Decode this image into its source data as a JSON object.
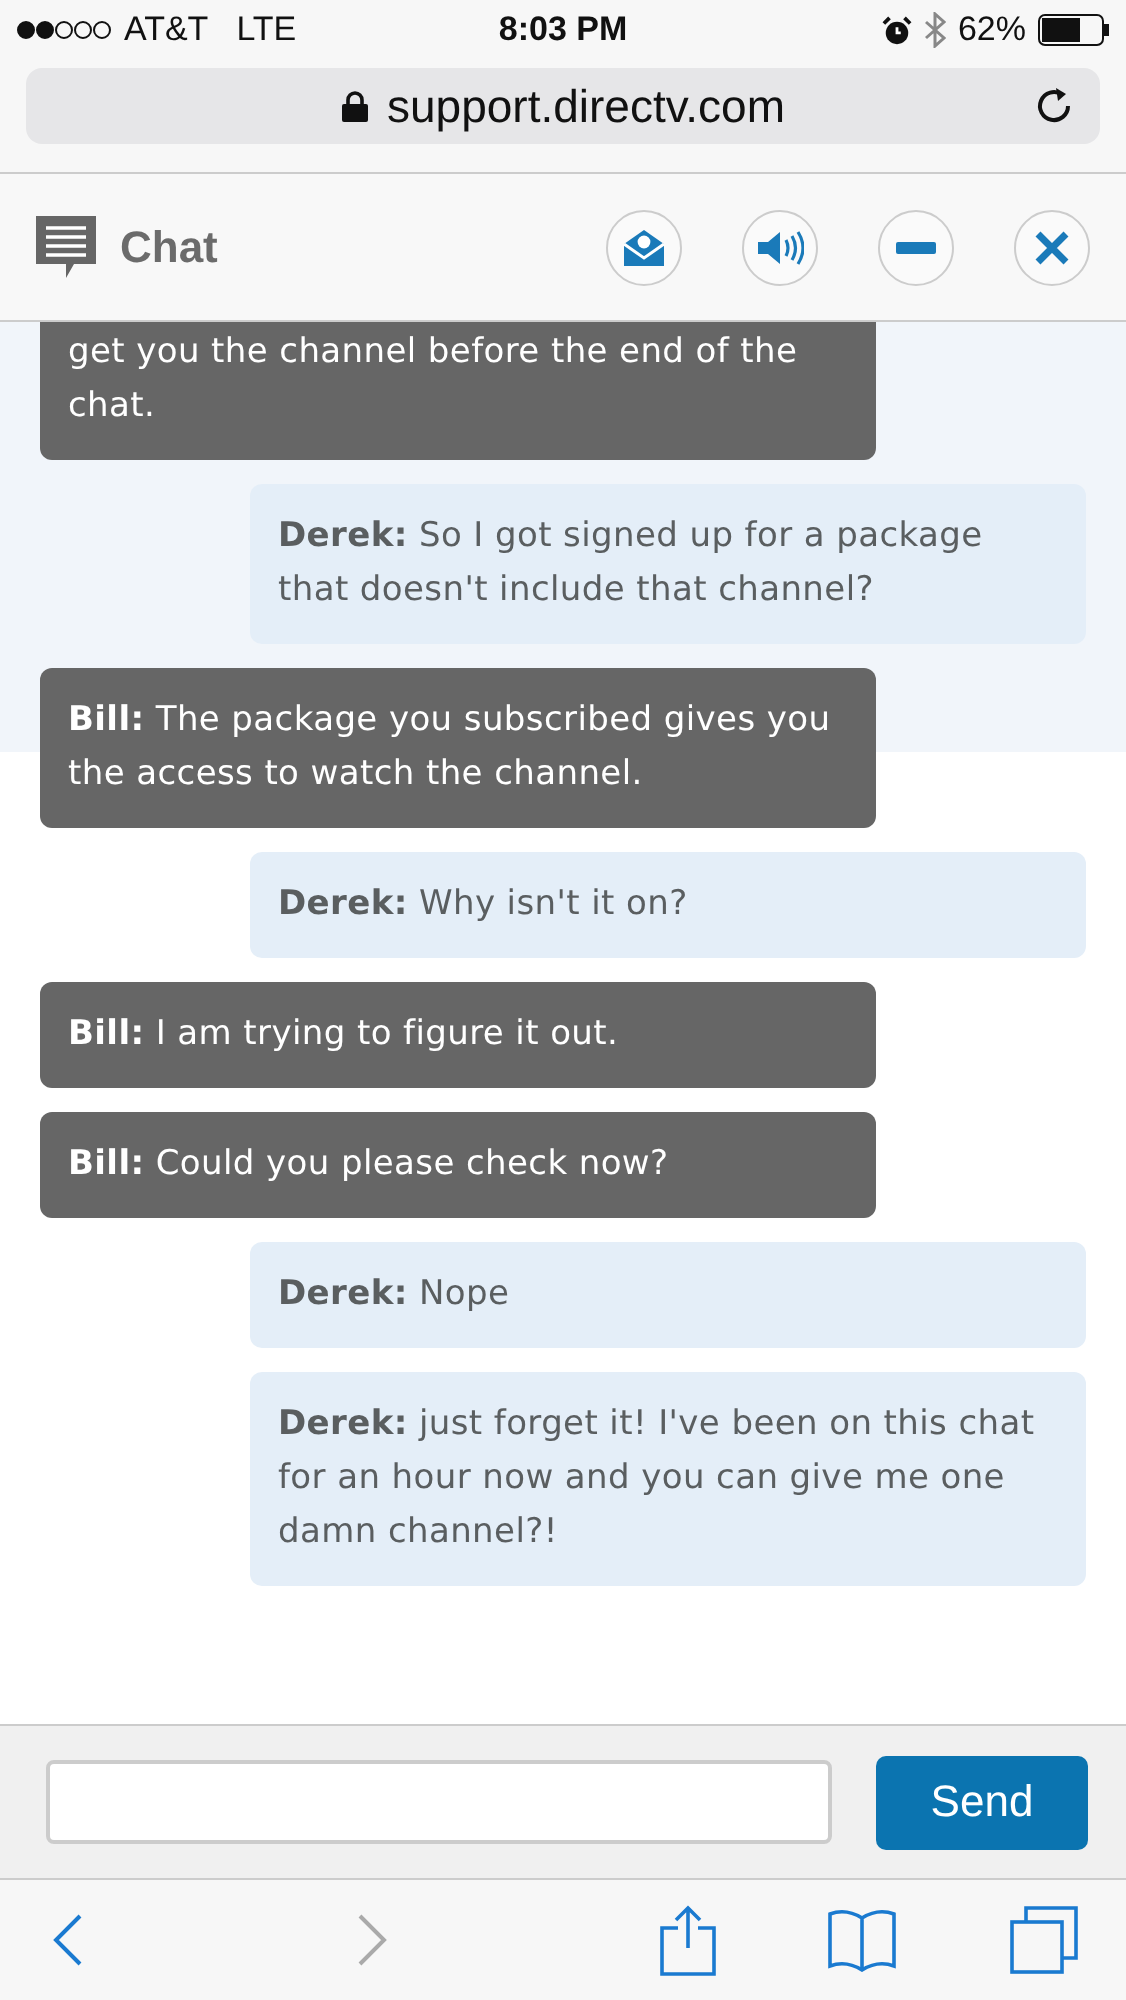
{
  "status_bar": {
    "carrier": "AT&T",
    "network": "LTE",
    "time": "8:03 PM",
    "battery": "62%"
  },
  "browser": {
    "url": "support.directv.com"
  },
  "chat": {
    "title": "Chat",
    "messages": [
      {
        "kind": "agent",
        "text": "get you the channel before the end of the chat."
      },
      {
        "kind": "customer",
        "sender": "Derek:",
        "text": "So I got signed up for a package that doesn't include that channel?"
      },
      {
        "kind": "agent",
        "sender": "Bill:",
        "text": "The package you subscribed gives you the access to watch the channel."
      },
      {
        "kind": "customer",
        "sender": "Derek:",
        "text": "Why isn't it on?"
      },
      {
        "kind": "agent",
        "sender": "Bill:",
        "text": "I am trying to figure it out."
      },
      {
        "kind": "agent",
        "sender": "Bill:",
        "text": "Could you please check now?"
      },
      {
        "kind": "customer",
        "sender": "Derek:",
        "text": "Nope"
      },
      {
        "kind": "customer",
        "sender": "Derek:",
        "text": "just forget it! I've been on this chat for an hour now and you can give me one damn channel?!"
      }
    ],
    "send_label": "Send"
  }
}
